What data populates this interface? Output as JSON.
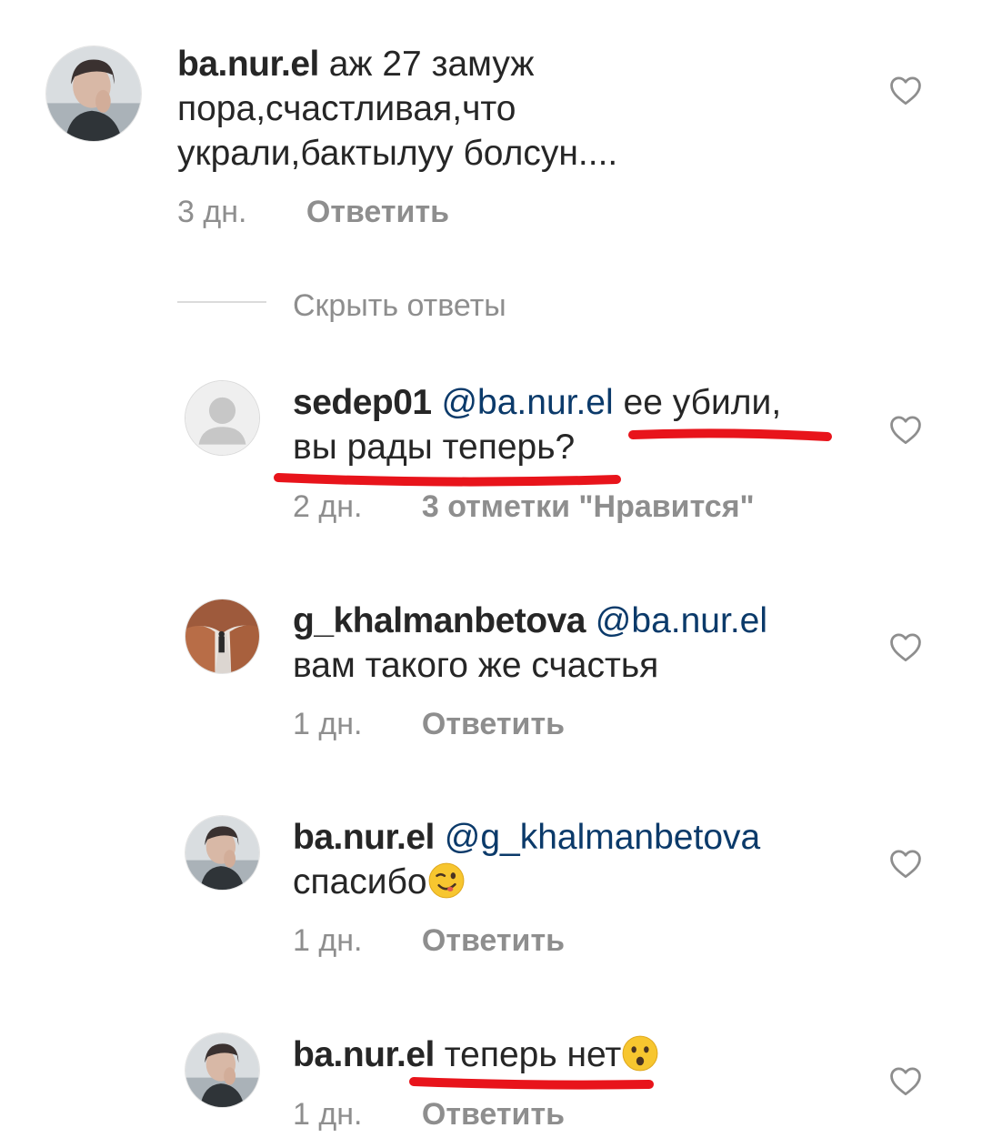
{
  "comment": {
    "username": "ba.nur.el",
    "line1": "аж 27 замуж",
    "line2": "пора,счастливая,что",
    "line3": "украли,бактылуу болсун....",
    "time": "3 дн.",
    "reply_label": "Ответить"
  },
  "hide_replies_label": "Скрыть ответы",
  "replies": [
    {
      "username": "sedep01",
      "mention": "@ba.nur.el",
      "text_line1": "ее убили,",
      "text_line2": "вы рады теперь?",
      "time": "2 дн.",
      "likes_label": "3 отметки \"Нравится\""
    },
    {
      "username": "g_khalmanbetova",
      "mention": "@ba.nur.el",
      "text_line2": "вам такого же счастья",
      "time": "1 дн.",
      "reply_label": "Ответить"
    },
    {
      "username": "ba.nur.el",
      "mention": "@g_khalmanbetova",
      "text_line2": "спасибо",
      "emoji": "winking-face-emoji",
      "time": "1 дн.",
      "reply_label": "Ответить"
    },
    {
      "username": "ba.nur.el",
      "text_line1": "теперь нет",
      "emoji": "surprised-face-emoji",
      "time": "1 дн.",
      "reply_label": "Ответить"
    }
  ],
  "colors": {
    "text": "#262626",
    "mention": "#0b3a6a",
    "meta": "#8e8e8e",
    "annotation_underline": "#e8141b"
  },
  "icons": [
    "heart-outline-icon",
    "default-avatar-icon"
  ]
}
